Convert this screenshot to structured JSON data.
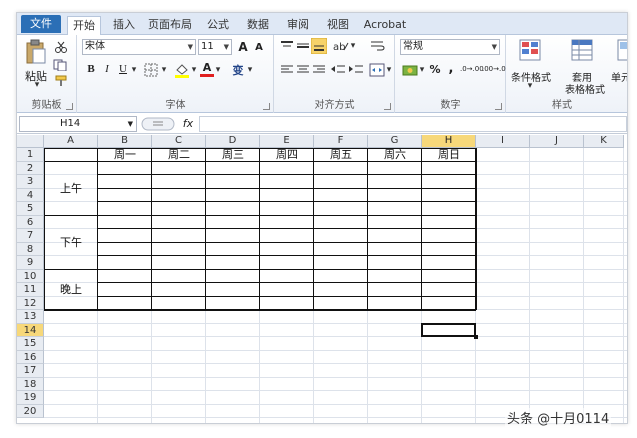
{
  "tabs": [
    "文件",
    "开始",
    "插入",
    "页面布局",
    "公式",
    "数据",
    "审阅",
    "视图",
    "Acrobat"
  ],
  "ribbon": {
    "clipboard": {
      "paste": "粘贴",
      "label": "剪贴板"
    },
    "font": {
      "name": "宋体",
      "size": "11",
      "grow": "A",
      "shrink": "A",
      "bold": "B",
      "italic": "I",
      "underline": "U",
      "font_color": "A",
      "phonetic": "变",
      "label": "字体"
    },
    "alignment": {
      "label": "对齐方式"
    },
    "number": {
      "format": "常规",
      "percent": "%",
      "comma": ",",
      "inc_decimal": ".0→.00",
      "dec_decimal": ".00→.0",
      "label": "数字"
    },
    "styles": {
      "conditional": "条件格式",
      "table_top": "套用",
      "table_bottom": "表格格式",
      "cell_styles": "单元格",
      "label": "样式"
    }
  },
  "formula_bar": {
    "name_box": "H14",
    "fx": "fx",
    "value": ""
  },
  "columns": [
    "A",
    "B",
    "C",
    "D",
    "E",
    "F",
    "G",
    "H",
    "I",
    "J",
    "K"
  ],
  "selected_column": "H",
  "rows": [
    "1",
    "2",
    "3",
    "4",
    "5",
    "6",
    "7",
    "8",
    "9",
    "10",
    "11",
    "12",
    "13",
    "14",
    "15",
    "16",
    "17",
    "18",
    "19",
    "20"
  ],
  "selected_row": "14",
  "sheet": {
    "weekdays": [
      "周一",
      "周二",
      "周三",
      "周四",
      "周五",
      "周六",
      "周日"
    ],
    "periods": [
      "上午",
      "下午",
      "晚上"
    ]
  },
  "watermark": "头条 @十月0114",
  "colors": {
    "file_tab": "#2b6fb6",
    "selected_header": "#f7d87a",
    "ribbon_bg": "#dfe8f5"
  }
}
